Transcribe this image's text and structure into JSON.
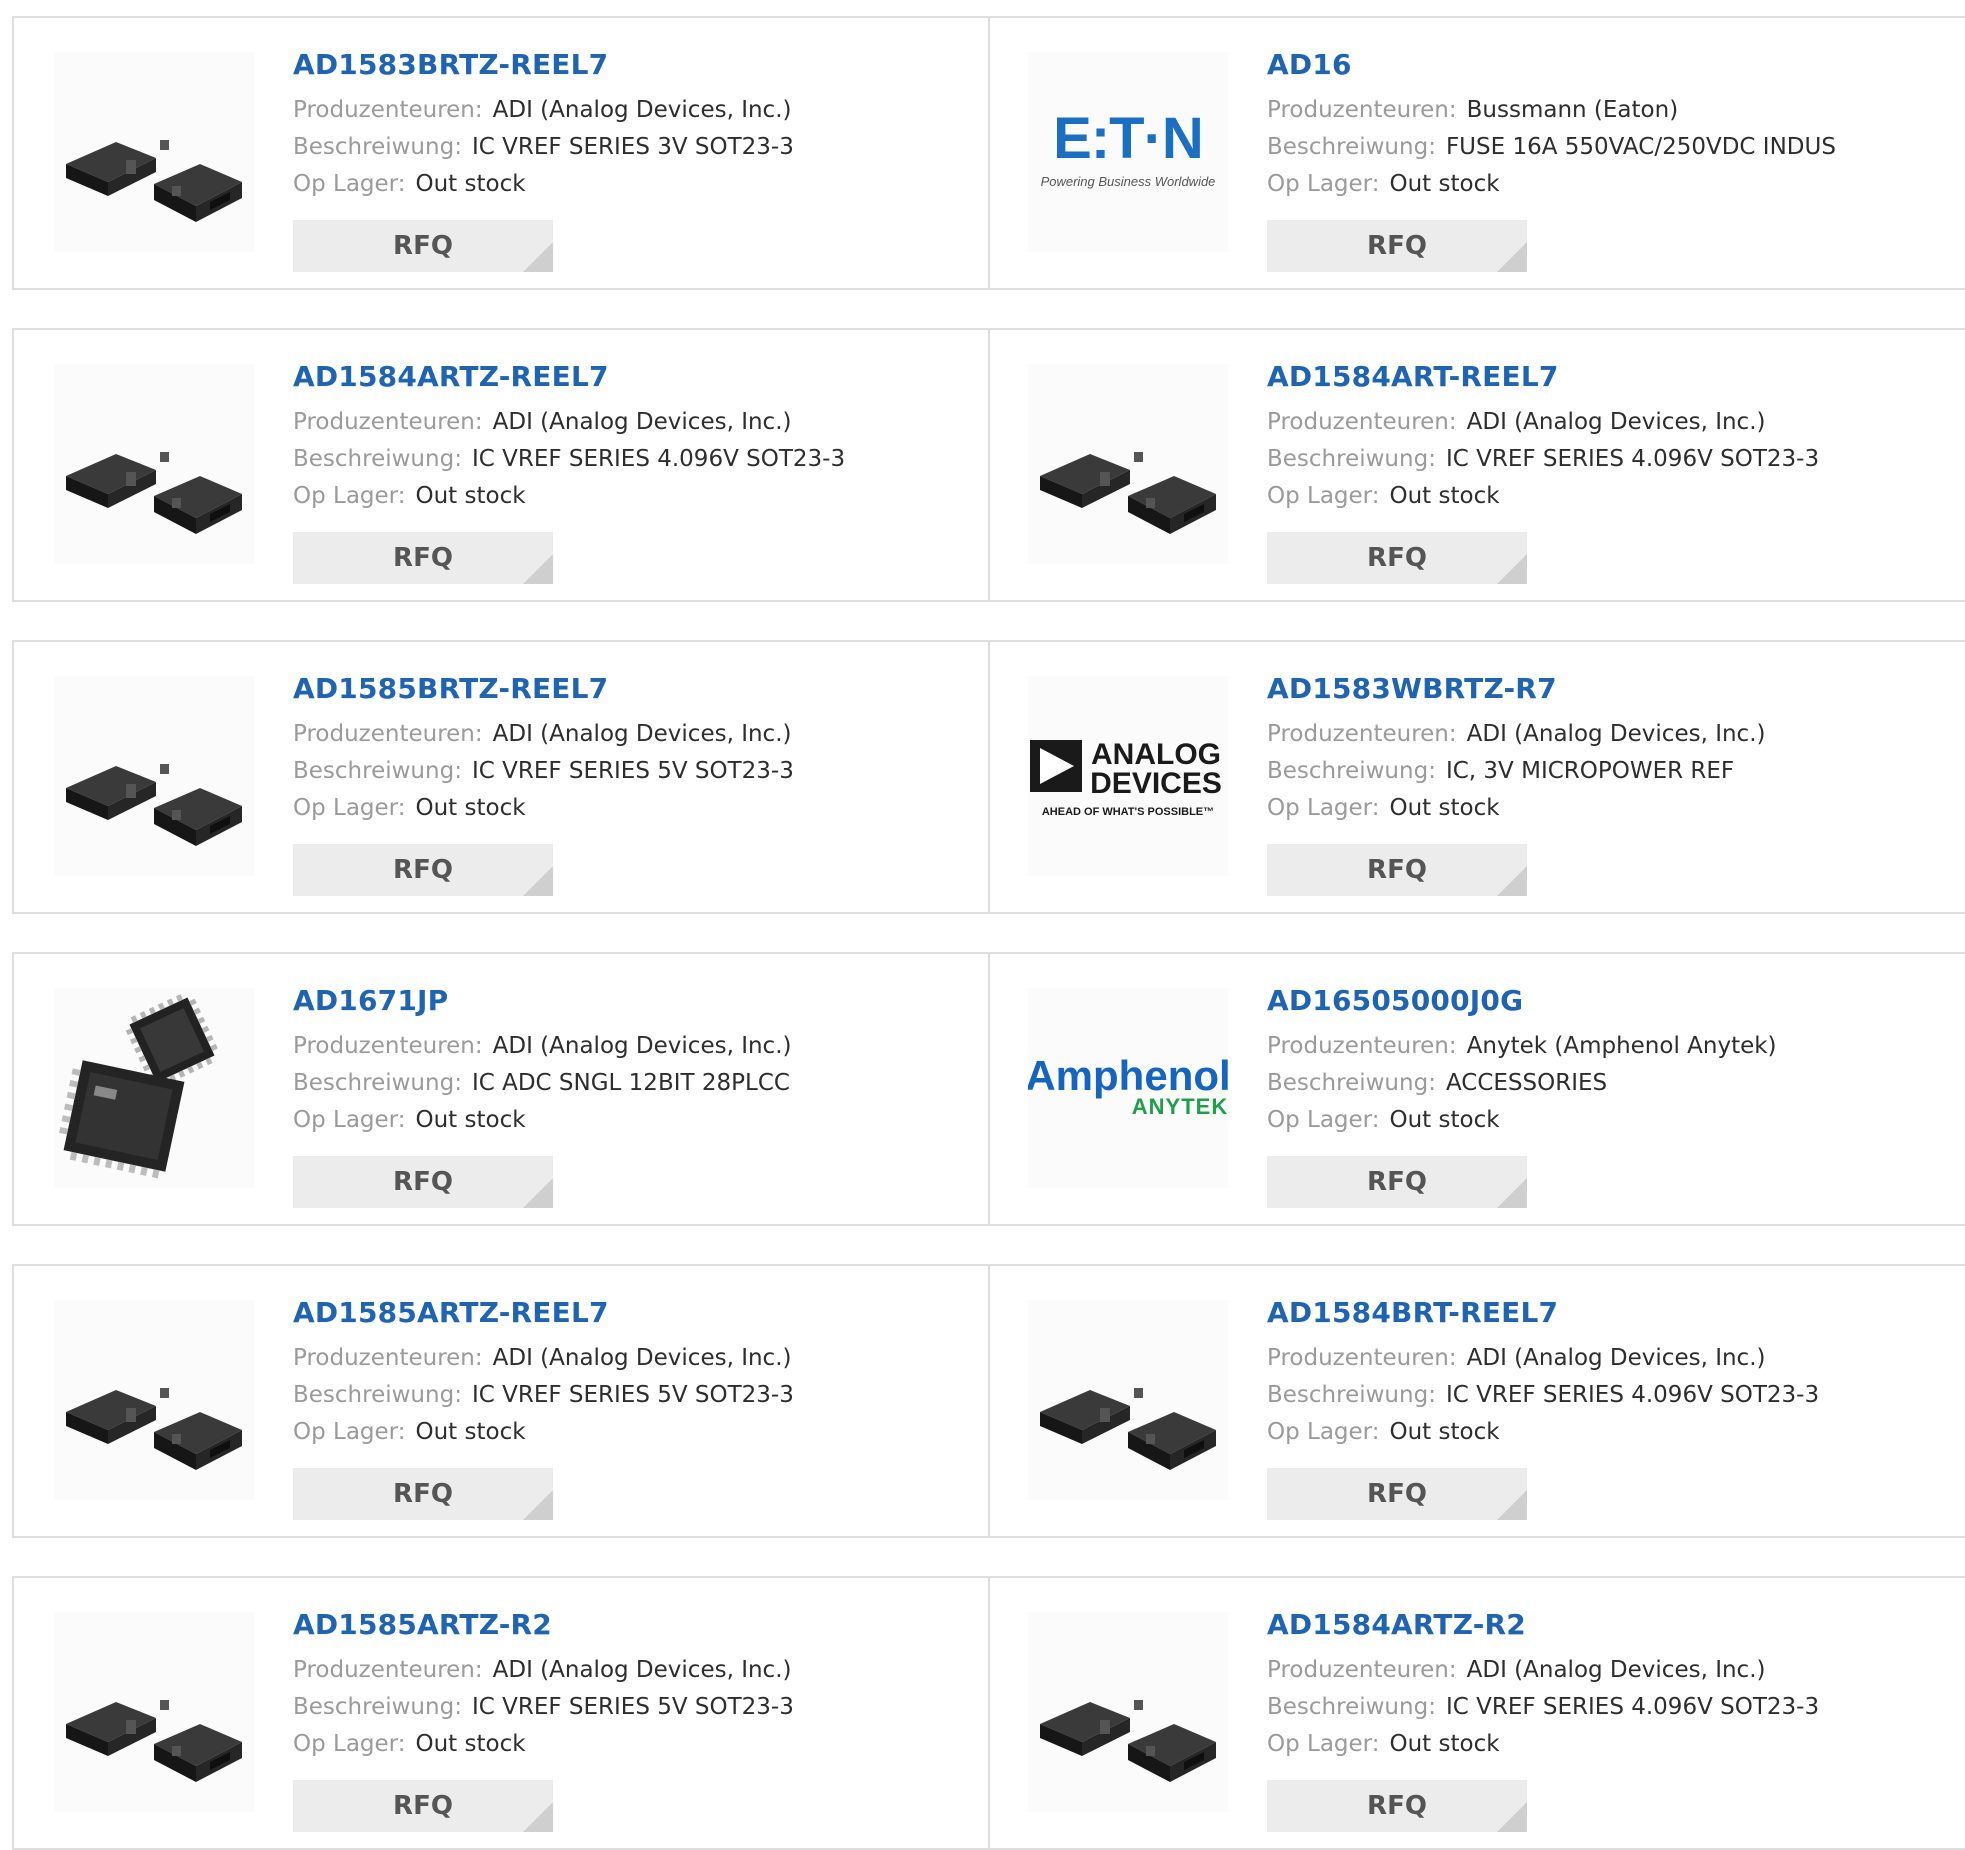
{
  "labels": {
    "manufacturer": "Produzenteuren:",
    "description": "Beschreiwung:",
    "stock": "Op Lager:",
    "rfq": "RFQ"
  },
  "logos": {
    "eaton_name": "E:T·N",
    "eaton_tagline": "Powering Business Worldwide",
    "adi_line1": "ANALOG",
    "adi_line2": "DEVICES",
    "adi_tagline": "AHEAD OF WHAT'S POSSIBLE™",
    "amphenol_name": "Amphenol",
    "amphenol_sub": "ANYTEK"
  },
  "products": [
    [
      {
        "part": "AD1583BRTZ-REEL7",
        "manufacturer": "ADI (Analog Devices, Inc.)",
        "description": "IC VREF SERIES 3V SOT23-3",
        "stock": "Out stock",
        "image": "sot23-3-package-icon"
      },
      {
        "part": "AD16",
        "manufacturer": "Bussmann (Eaton)",
        "description": "FUSE 16A 550VAC/250VDC INDUS",
        "stock": "Out stock",
        "image": "eaton-logo"
      }
    ],
    [
      {
        "part": "AD1584ARTZ-REEL7",
        "manufacturer": "ADI (Analog Devices, Inc.)",
        "description": "IC VREF SERIES 4.096V SOT23-3",
        "stock": "Out stock",
        "image": "sot23-3-package-icon"
      },
      {
        "part": "AD1584ART-REEL7",
        "manufacturer": "ADI (Analog Devices, Inc.)",
        "description": "IC VREF SERIES 4.096V SOT23-3",
        "stock": "Out stock",
        "image": "sot23-3-package-icon"
      }
    ],
    [
      {
        "part": "AD1585BRTZ-REEL7",
        "manufacturer": "ADI (Analog Devices, Inc.)",
        "description": "IC VREF SERIES 5V SOT23-3",
        "stock": "Out stock",
        "image": "sot23-3-package-icon"
      },
      {
        "part": "AD1583WBRTZ-R7",
        "manufacturer": "ADI (Analog Devices, Inc.)",
        "description": "IC, 3V MICROPOWER REF",
        "stock": "Out stock",
        "image": "analog-devices-logo"
      }
    ],
    [
      {
        "part": "AD1671JP",
        "manufacturer": "ADI (Analog Devices, Inc.)",
        "description": "IC ADC SNGL 12BIT 28PLCC",
        "stock": "Out stock",
        "image": "plcc-package-icon"
      },
      {
        "part": "AD16505000J0G",
        "manufacturer": "Anytek (Amphenol Anytek)",
        "description": "ACCESSORIES",
        "stock": "Out stock",
        "image": "amphenol-logo"
      }
    ],
    [
      {
        "part": "AD1585ARTZ-REEL7",
        "manufacturer": "ADI (Analog Devices, Inc.)",
        "description": "IC VREF SERIES 5V SOT23-3",
        "stock": "Out stock",
        "image": "sot23-3-package-icon"
      },
      {
        "part": "AD1584BRT-REEL7",
        "manufacturer": "ADI (Analog Devices, Inc.)",
        "description": "IC VREF SERIES 4.096V SOT23-3",
        "stock": "Out stock",
        "image": "sot23-3-package-icon"
      }
    ],
    [
      {
        "part": "AD1585ARTZ-R2",
        "manufacturer": "ADI (Analog Devices, Inc.)",
        "description": "IC VREF SERIES 5V SOT23-3",
        "stock": "Out stock",
        "image": "sot23-3-package-icon"
      },
      {
        "part": "AD1584ARTZ-R2",
        "manufacturer": "ADI (Analog Devices, Inc.)",
        "description": "IC VREF SERIES 4.096V SOT23-3",
        "stock": "Out stock",
        "image": "sot23-3-package-icon"
      }
    ]
  ]
}
